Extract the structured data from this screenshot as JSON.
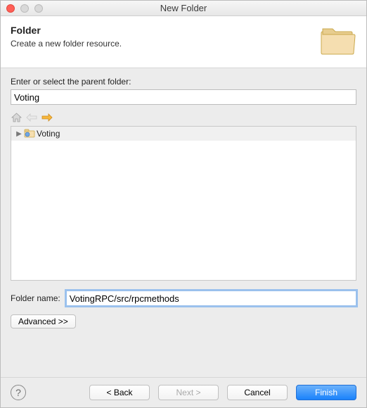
{
  "titlebar": {
    "title": "New Folder"
  },
  "banner": {
    "title": "Folder",
    "description": "Create a new folder resource."
  },
  "parent": {
    "label": "Enter or select the parent folder:",
    "value": "Voting"
  },
  "tree": {
    "items": [
      {
        "label": "Voting"
      }
    ]
  },
  "folderName": {
    "label": "Folder name:",
    "value": "VotingRPC/src/rpcmethods"
  },
  "advanced": {
    "label": "Advanced >>"
  },
  "footer": {
    "back": "< Back",
    "next": "Next >",
    "cancel": "Cancel",
    "finish": "Finish"
  }
}
